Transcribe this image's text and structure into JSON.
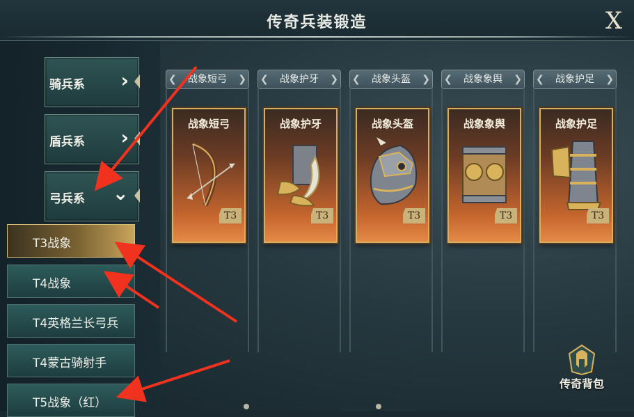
{
  "header": {
    "title": "传奇兵装锻造",
    "close_label": "X"
  },
  "categories": [
    {
      "label": "骑兵系",
      "arrow": "›"
    },
    {
      "label": "盾兵系",
      "arrow": "›"
    },
    {
      "label": "弓兵系",
      "arrow": "⌄"
    }
  ],
  "sub_items": [
    {
      "label": "T3战象",
      "active": true
    },
    {
      "label": "T4战象",
      "active": false
    },
    {
      "label": "T4英格兰长弓兵",
      "active": false
    },
    {
      "label": "T4蒙古骑射手",
      "active": false
    },
    {
      "label": "T5战象（红）",
      "active": false
    }
  ],
  "slots": [
    {
      "tab": "战象短弓",
      "card": "战象短弓",
      "tier": "T3",
      "icon": "bow-icon"
    },
    {
      "tab": "战象护牙",
      "card": "战象护牙",
      "tier": "T3",
      "icon": "tusk-guard-icon"
    },
    {
      "tab": "战象头盔",
      "card": "战象头盔",
      "tier": "T3",
      "icon": "helmet-icon"
    },
    {
      "tab": "战象象舆",
      "card": "战象象舆",
      "tier": "T3",
      "icon": "howdah-icon"
    },
    {
      "tab": "战象护足",
      "card": "战象护足",
      "tier": "T3",
      "icon": "leg-guard-icon"
    }
  ],
  "backpack": {
    "label": "传奇背包",
    "icon": "spartan-helmet-icon"
  },
  "colors": {
    "accent_gold": "#d5b061",
    "annotation_red": "#f0321e",
    "panel_teal": "#2e5b5b"
  }
}
